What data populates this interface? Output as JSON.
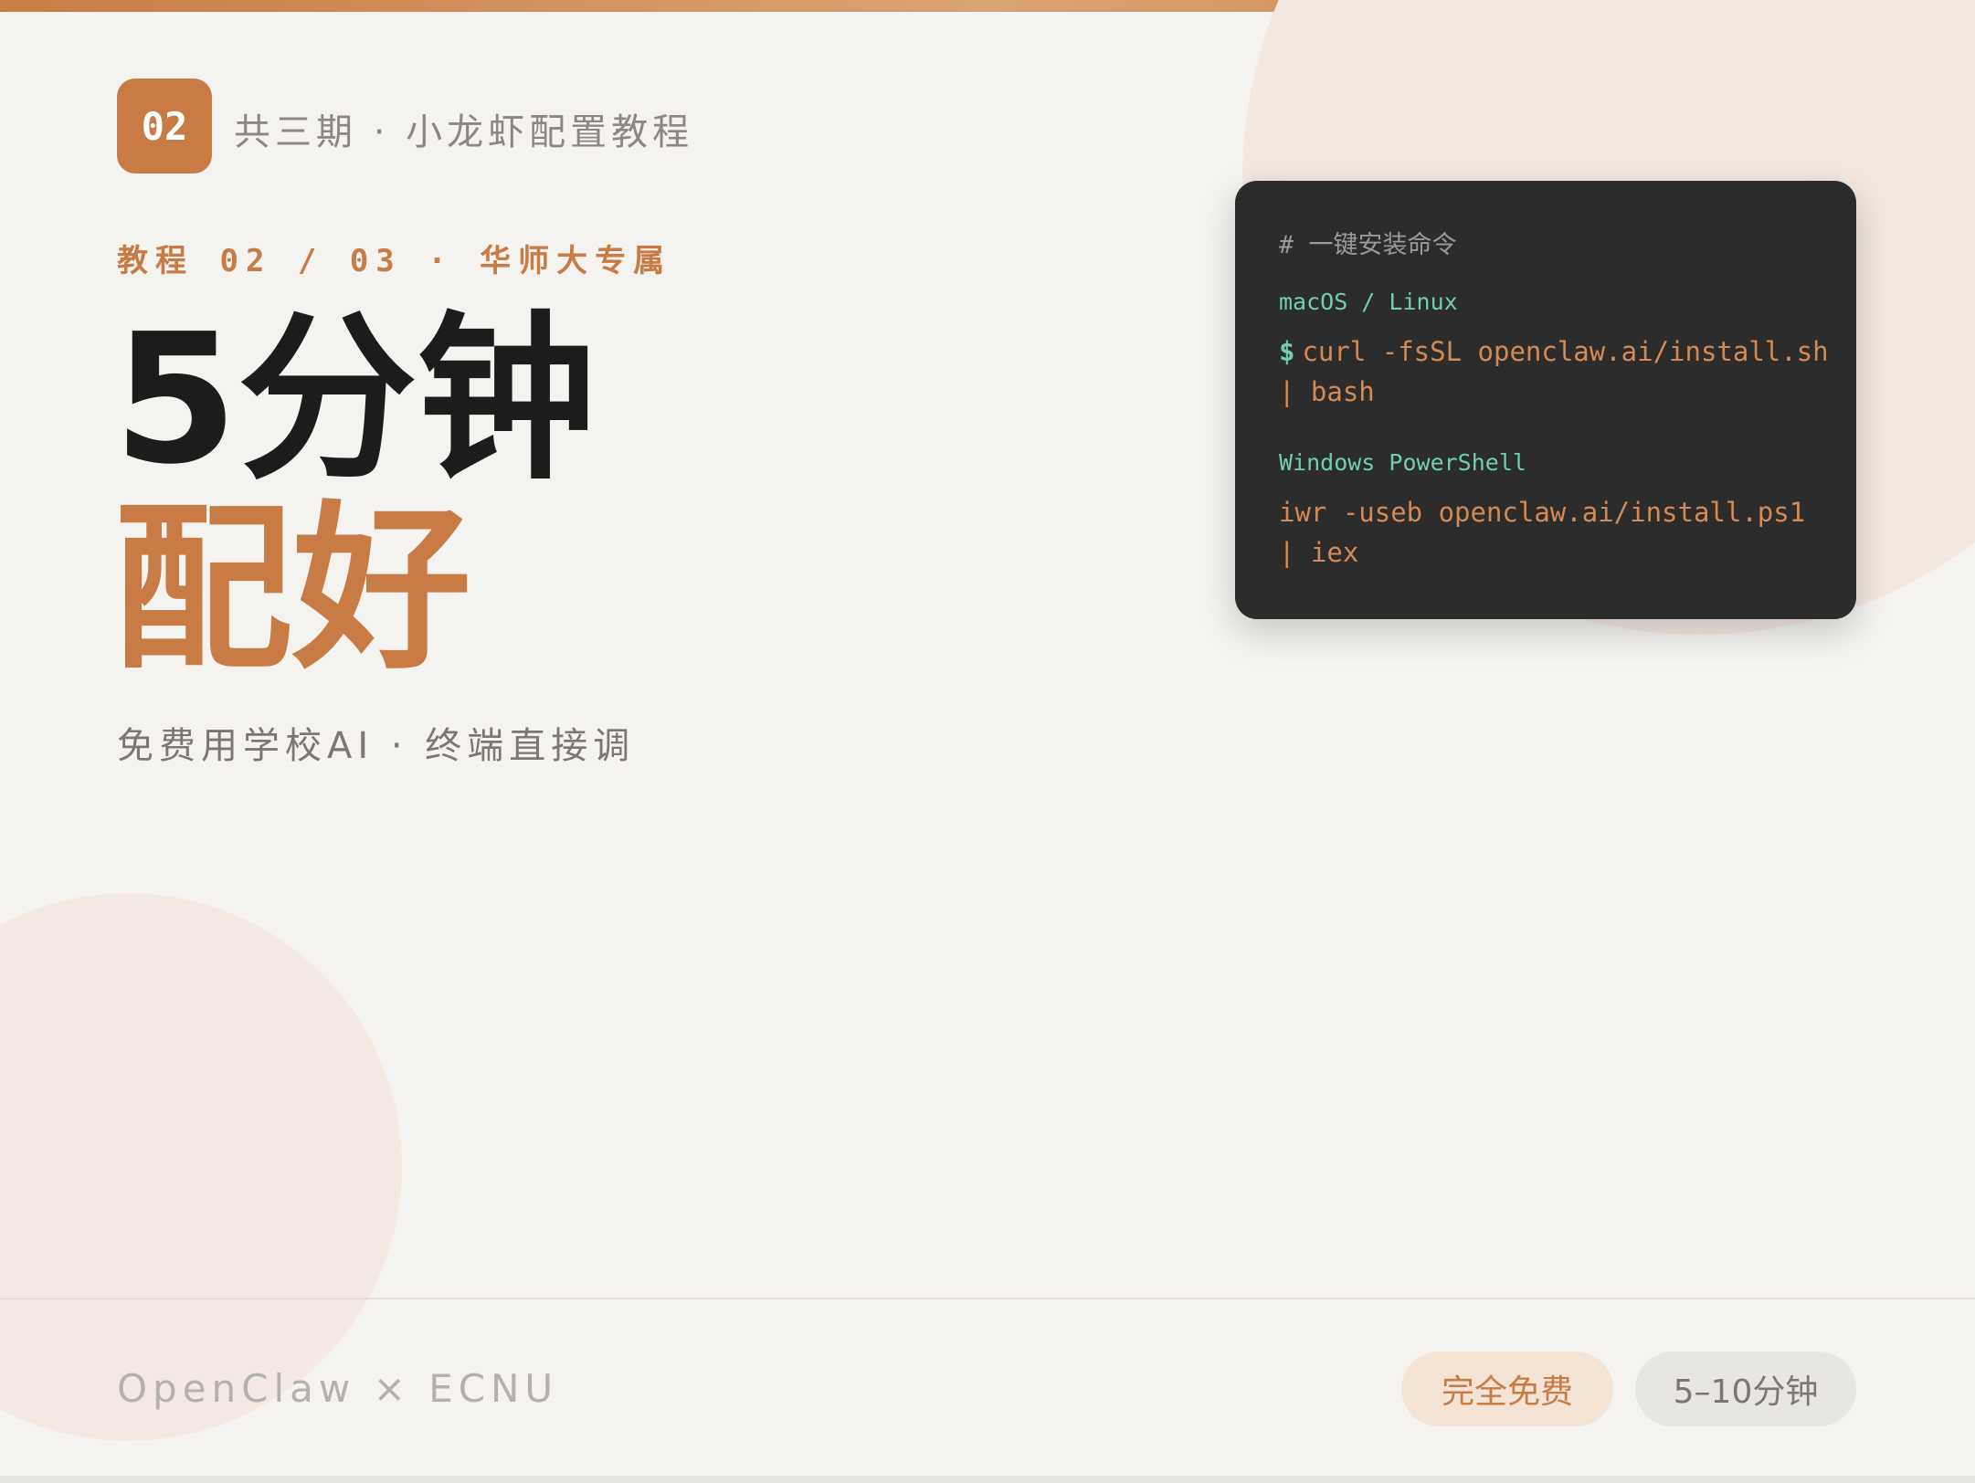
{
  "badge": {
    "number": "02"
  },
  "header": {
    "series_text": "共三期 · 小龙虾配置教程",
    "eyebrow": "教程 02 / 03 · 华师大专属"
  },
  "title": {
    "line1": "5分钟",
    "line2": "配好"
  },
  "tagline": "免费用学校AI · 终端直接调",
  "terminal": {
    "comment": "# 一键安装命令",
    "mac_label": "macOS / Linux",
    "prompt_symbol": "$",
    "mac_cmd_line1": "curl -fsSL openclaw.ai/install.sh",
    "mac_cmd_line2": "| bash",
    "win_label": "Windows PowerShell",
    "win_cmd_line1": "iwr -useb openclaw.ai/install.ps1",
    "win_cmd_line2": "| iex"
  },
  "footer": {
    "brand": "OpenClaw × ECNU",
    "pill_free": "完全免费",
    "pill_time": "5–10分钟"
  },
  "colors": {
    "accent": "#c87b45",
    "background": "#f5f3ef",
    "terminal_bg": "#2c2c2c",
    "terminal_label": "#6fcfae",
    "terminal_cmd": "#d48a52",
    "title_dark": "#1c1c1c"
  }
}
